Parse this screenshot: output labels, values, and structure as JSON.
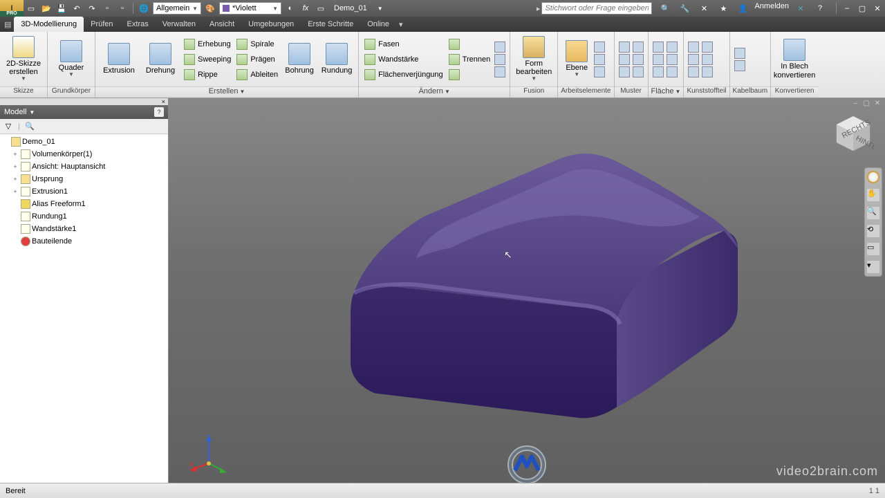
{
  "titlebar": {
    "logo_sub": "PRO",
    "combo_general": "Allgemein",
    "combo_color": "*Violett",
    "doc_name": "Demo_01",
    "search_placeholder": "Stichwort oder Frage eingeben",
    "signin": "Anmelden"
  },
  "menubar": {
    "tabs": [
      "3D-Modellierung",
      "Prüfen",
      "Extras",
      "Verwalten",
      "Ansicht",
      "Umgebungen",
      "Erste Schritte",
      "Online"
    ]
  },
  "ribbon": {
    "groups": {
      "skizze": {
        "label": "Skizze",
        "btn": "2D-Skizze\nerstellen"
      },
      "grund": {
        "label": "Grundkörper",
        "btn": "Quader"
      },
      "erstellen": {
        "label": "Erstellen",
        "big": [
          "Extrusion",
          "Drehung"
        ],
        "small": [
          "Erhebung",
          "Spirale",
          "Sweeping",
          "Prägen",
          "Rippe",
          "Ableiten"
        ],
        "extra": [
          "Bohrung",
          "Rundung"
        ]
      },
      "aendern": {
        "label": "Ändern",
        "small": [
          "Fasen",
          "Wandstärke",
          "Flächenverjüngung",
          "Trennen"
        ]
      },
      "fusion": {
        "label": "Fusion",
        "btn": "Form\nbearbeiten"
      },
      "arbeit": {
        "label": "Arbeitselemente",
        "btn": "Ebene"
      },
      "muster": {
        "label": "Muster"
      },
      "flaeche": {
        "label": "Fläche"
      },
      "kunst": {
        "label": "Kunststoffteil"
      },
      "kabel": {
        "label": "Kabelbaum"
      },
      "konv": {
        "label": "Konvertieren",
        "btn": "In Blech\nkonvertieren"
      }
    }
  },
  "browser": {
    "header": "Modell",
    "root": "Demo_01",
    "items": [
      {
        "label": "Volumenkörper(1)",
        "exp": "+"
      },
      {
        "label": "Ansicht: Hauptansicht",
        "exp": "+"
      },
      {
        "label": "Ursprung",
        "exp": "+"
      },
      {
        "label": "Extrusion1",
        "exp": "+"
      },
      {
        "label": "Alias Freeform1",
        "exp": ""
      },
      {
        "label": "Rundung1",
        "exp": ""
      },
      {
        "label": "Wandstärke1",
        "exp": ""
      },
      {
        "label": "Bauteilende",
        "exp": ""
      }
    ]
  },
  "viewcube": {
    "face1": "RECHTS",
    "face2": "HINTEN"
  },
  "triad": {
    "x": "x",
    "z": "z"
  },
  "status": {
    "left": "Bereit",
    "right": "1         1"
  },
  "watermark": "video2brain.com"
}
